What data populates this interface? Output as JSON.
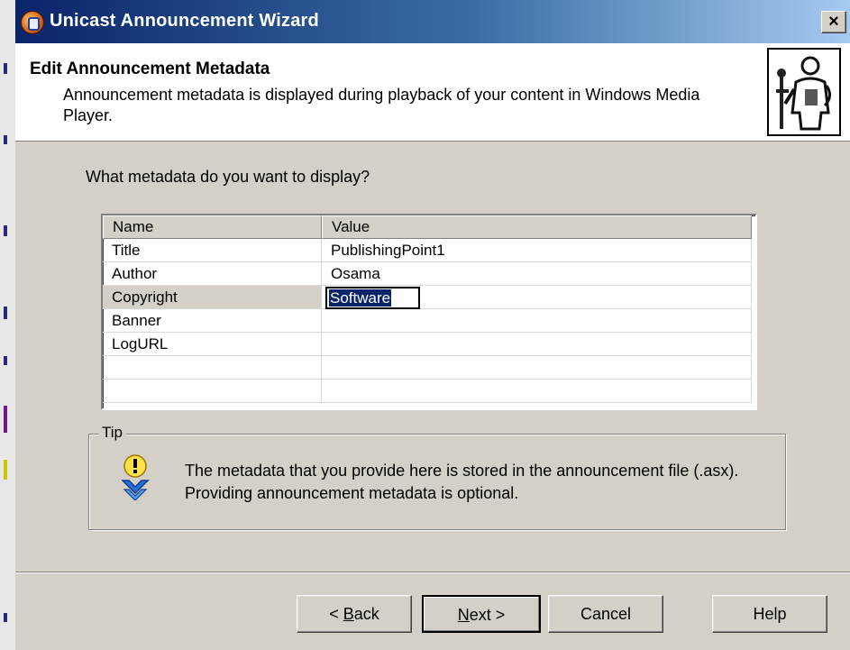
{
  "window": {
    "title": "Unicast Announcement Wizard",
    "close_label": "×"
  },
  "header": {
    "title": "Edit Announcement Metadata",
    "description": "Announcement metadata is displayed during playback of your content in Windows Media Player."
  },
  "main": {
    "question": "What metadata do you want to display?",
    "table": {
      "columns": [
        "Name",
        "Value"
      ],
      "rows": [
        {
          "name": "Title",
          "value": "PublishingPoint1"
        },
        {
          "name": "Author",
          "value": "Osama"
        },
        {
          "name": "Copyright",
          "value": "Software"
        },
        {
          "name": "Banner",
          "value": ""
        },
        {
          "name": "LogURL",
          "value": ""
        }
      ]
    }
  },
  "tip": {
    "label": "Tip",
    "text": "The metadata that you provide here is stored in the announcement file (.asx). Providing announcement metadata is optional."
  },
  "buttons": {
    "back": {
      "pre": "< ",
      "accel": "B",
      "post": "ack"
    },
    "next": {
      "accel": "N",
      "post": "ext >"
    },
    "cancel": "Cancel",
    "help": "Help"
  },
  "icons": {
    "app": "wizard-app-icon",
    "header": "person-figure-icon",
    "tip": "tip-info-icon",
    "close": "close-icon"
  }
}
